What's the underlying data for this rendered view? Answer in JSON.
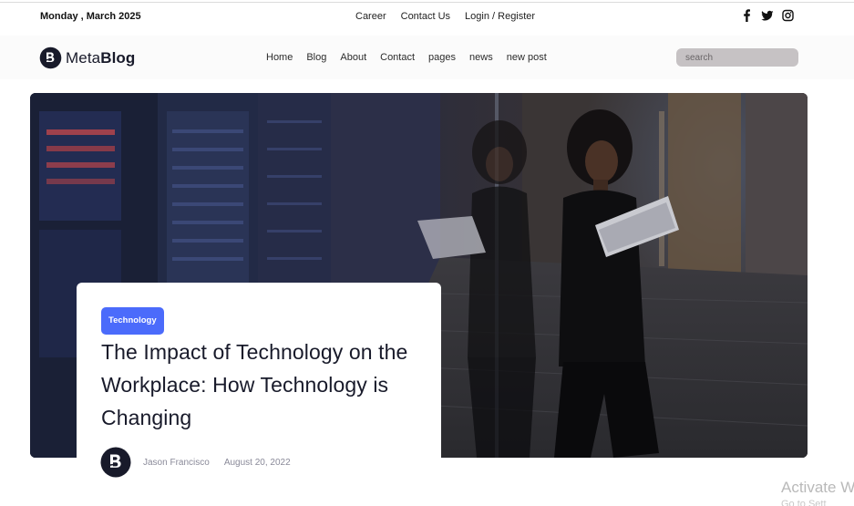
{
  "topbar": {
    "date": "Monday , March 2025",
    "links": [
      "Career",
      "Contact Us",
      "Login / Register"
    ],
    "social_icons": [
      "facebook-icon",
      "twitter-icon",
      "instagram-icon"
    ]
  },
  "header": {
    "logo_light": "Meta",
    "logo_bold": "Blog",
    "nav": [
      "Home",
      "Blog",
      "About",
      "Contact",
      "pages",
      "news",
      "new post"
    ],
    "search_placeholder": "search"
  },
  "hero": {
    "image": "woman-with-laptop-server-room-photo",
    "category": "Technology",
    "title": "The Impact of Technology on the Workplace: How Technology is Changing",
    "author": "Jason Francisco",
    "date": "August 20, 2022"
  },
  "watermark": {
    "line1": "Activate W",
    "line2": "Go to Sett"
  },
  "colors": {
    "accent": "#4b6bfb",
    "text": "#181a2a",
    "muted": "#8a8a99",
    "search_bg": "#c6c2c4"
  }
}
